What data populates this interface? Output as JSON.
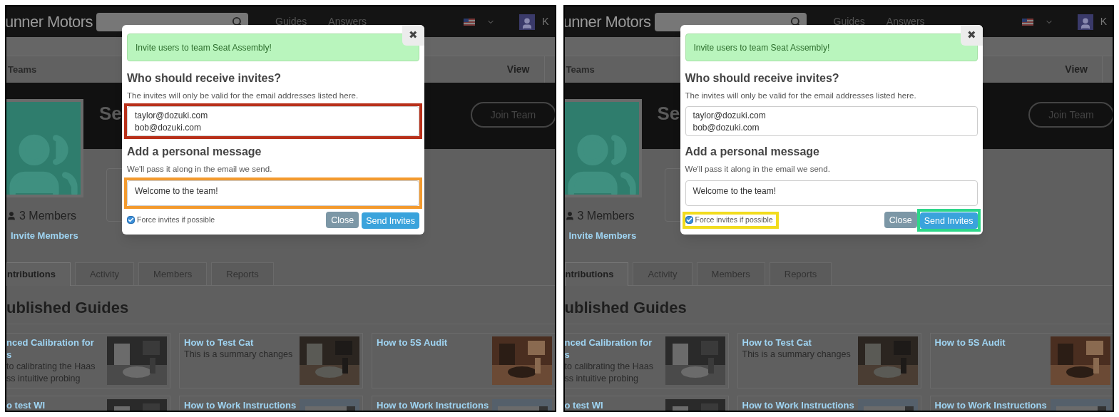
{
  "panels": [
    {
      "navbar": {
        "logo": "unner Motors",
        "links": [
          "Guides",
          "Answers"
        ],
        "user_initial": "K"
      },
      "breadcrumb": "Teams",
      "view_button": "View",
      "team": {
        "name_fragment": "Se",
        "join_button": "Join Team",
        "members": "3 Members",
        "invite_link": "Invite Members"
      },
      "tabs": [
        {
          "label": "ntributions",
          "selected": true
        },
        {
          "label": "Activity",
          "selected": false
        },
        {
          "label": "Members",
          "selected": false
        },
        {
          "label": "Reports",
          "selected": false
        }
      ],
      "section_title": "ublished Guides",
      "guides": [
        {
          "title_lines": [
            "nced Calibration for",
            "s"
          ],
          "summary_lines": [
            "to calibrating the Haas",
            "ss intuitive probing"
          ]
        },
        {
          "title_lines": [
            "How to Test Cat"
          ],
          "summary_lines": [
            "This is a summary changes"
          ]
        },
        {
          "title_lines": [
            "How to 5S Audit"
          ]
        },
        {
          "title_lines": [
            "o test WI"
          ]
        },
        {
          "title_lines": [
            "How to Work Instructions"
          ]
        },
        {
          "title_lines": [
            "How to Work Instructions"
          ]
        }
      ],
      "modal": {
        "close_icon": "✖",
        "alert": "Invite users to team Seat Assembly!",
        "recipients_heading": "Who should receive invites?",
        "recipients_help": "The invites will only be valid for the email addresses listed here.",
        "emails": "taylor@dozuki.com\nbob@dozuki.com",
        "emails_frame": {
          "color": "#b8301a"
        },
        "message_heading": "Add a personal message",
        "message_help": "We'll pass it along in the email we send.",
        "message": "Welcome to the team!",
        "message_frame": {
          "color": "#f39a2e"
        },
        "force": {
          "label": "Force invites if possible",
          "checked": true
        },
        "close_button": "Close",
        "send_button": "Send Invites"
      }
    },
    {
      "navbar": {
        "logo": "unner Motors",
        "links": [
          "Guides",
          "Answers"
        ],
        "user_initial": "K"
      },
      "breadcrumb": "Teams",
      "view_button": "View",
      "team": {
        "name_fragment": "Se",
        "join_button": "Join Team",
        "members": "3 Members",
        "invite_link": "Invite Members"
      },
      "tabs": [
        {
          "label": "ntributions",
          "selected": true
        },
        {
          "label": "Activity",
          "selected": false
        },
        {
          "label": "Members",
          "selected": false
        },
        {
          "label": "Reports",
          "selected": false
        }
      ],
      "section_title": "ublished Guides",
      "guides": [
        {
          "title_lines": [
            "nced Calibration for",
            "s"
          ],
          "summary_lines": [
            "to calibrating the Haas",
            "ss intuitive probing"
          ]
        },
        {
          "title_lines": [
            "How to Test Cat"
          ],
          "summary_lines": [
            "This is a summary changes"
          ]
        },
        {
          "title_lines": [
            "How to 5S Audit"
          ]
        },
        {
          "title_lines": [
            "o test WI"
          ]
        },
        {
          "title_lines": [
            "How to Work Instructions"
          ]
        },
        {
          "title_lines": [
            "How to Work Instructions"
          ]
        }
      ],
      "modal": {
        "close_icon": "✖",
        "alert": "Invite users to team Seat Assembly!",
        "recipients_heading": "Who should receive invites?",
        "recipients_help": "The invites will only be valid for the email addresses listed here.",
        "emails": "taylor@dozuki.com\nbob@dozuki.com",
        "message_heading": "Add a personal message",
        "message_help": "We'll pass it along in the email we send.",
        "message": "Welcome to the team!",
        "force": {
          "label": "Force invites if possible",
          "checked": true,
          "frame": {
            "color": "#f2dc1e"
          }
        },
        "close_button": "Close",
        "send_button": "Send Invites",
        "send_frame": {
          "color": "#2ed68a"
        }
      }
    }
  ]
}
